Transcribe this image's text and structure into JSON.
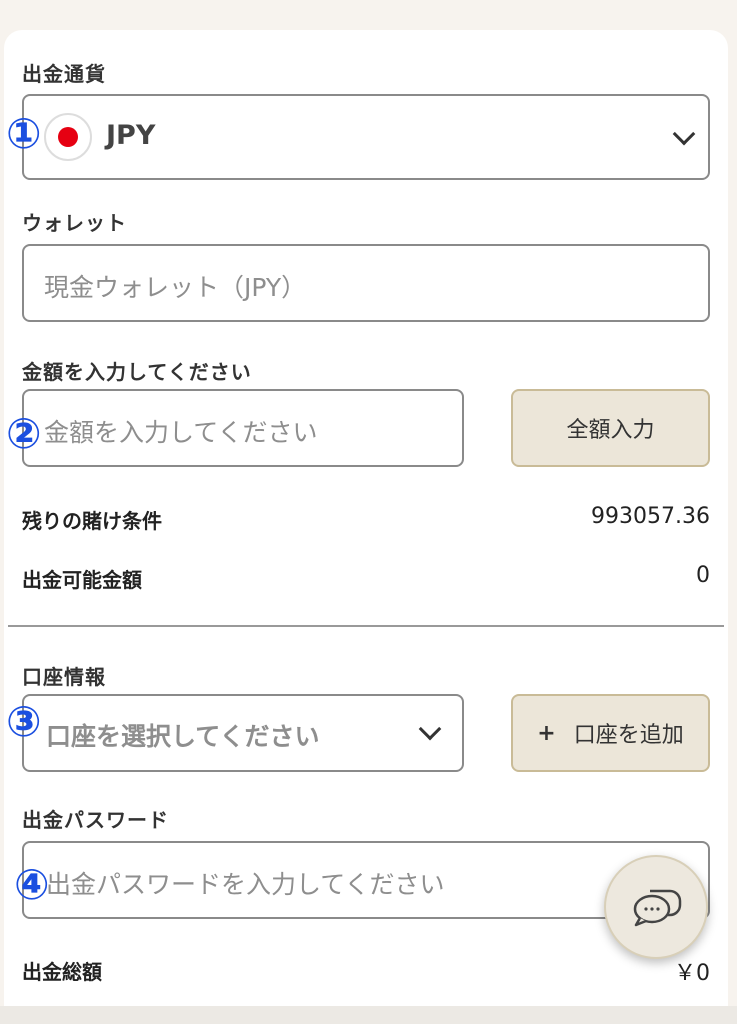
{
  "currency": {
    "label": "出金通貨",
    "value": "JPY",
    "marker": "①",
    "flag_icon": "japan-flag-icon",
    "dropdown_icon": "chevron-down-icon"
  },
  "wallet": {
    "label": "ウォレット",
    "value": "現金ウォレット（JPY）"
  },
  "amount": {
    "label": "金額を入力してください",
    "placeholder": "金額を入力してください",
    "marker": "②",
    "max_button": "全額入力"
  },
  "summary": {
    "remaining_label": "残りの賭け条件",
    "remaining_value": "993057.36",
    "available_label": "出金可能金額",
    "available_value": "0"
  },
  "account": {
    "label": "口座情報",
    "placeholder": "口座を選択してください",
    "marker": "③",
    "add_icon": "+",
    "add_label": "口座を追加",
    "dropdown_icon": "chevron-down-icon"
  },
  "password": {
    "label": "出金パスワード",
    "placeholder": "出金パスワードを入力してください",
    "marker": "④"
  },
  "total": {
    "label": "出金総額",
    "value": "￥0"
  },
  "chat": {
    "icon": "chat-bubbles-icon"
  },
  "colors": {
    "marker": "#1b4fe0",
    "button_bg": "#ece6d9",
    "button_border": "#c9bb97",
    "flag_red": "#e60012"
  }
}
